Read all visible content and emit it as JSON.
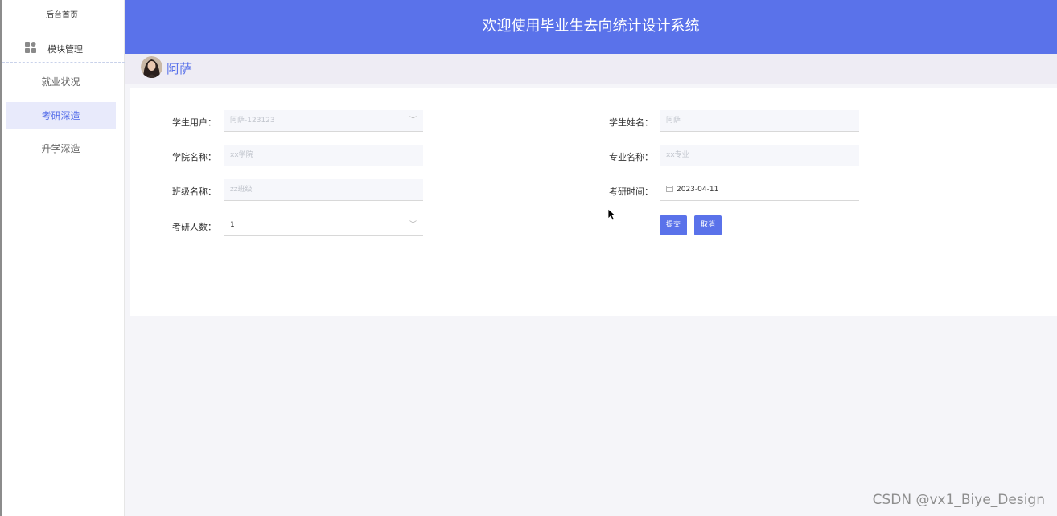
{
  "sidebar": {
    "home_label": "后台首页",
    "module_label": "模块管理",
    "module_icon": "module-grid-icon",
    "items": [
      {
        "label": "就业状况"
      },
      {
        "label": "考研深造"
      },
      {
        "label": "升学深造"
      }
    ],
    "active_index": 1
  },
  "header": {
    "title": "欢迎使用毕业生去向统计设计系统"
  },
  "user": {
    "name": "阿萨",
    "avatar_icon": "avatar-icon"
  },
  "form": {
    "student_user": {
      "label": "学生用户：",
      "value": "阿萨-123123"
    },
    "student_name": {
      "label": "学生姓名：",
      "value": "阿萨"
    },
    "college_name": {
      "label": "学院名称：",
      "value": "xx学院"
    },
    "major_name": {
      "label": "专业名称：",
      "value": "xx专业"
    },
    "class_name": {
      "label": "班级名称：",
      "value": "zz班级"
    },
    "exam_time": {
      "label": "考研时间：",
      "value": "2023-04-11"
    },
    "exam_count": {
      "label": "考研人数：",
      "value": "1"
    },
    "submit_label": "提交",
    "cancel_label": "取消"
  },
  "watermark": "CSDN @vx1_Biye_Design",
  "colors": {
    "accent": "#5a72ea",
    "active_bg": "#e8eafb",
    "input_bg": "#f6f7fb",
    "page_bg": "#f5f5f9"
  }
}
